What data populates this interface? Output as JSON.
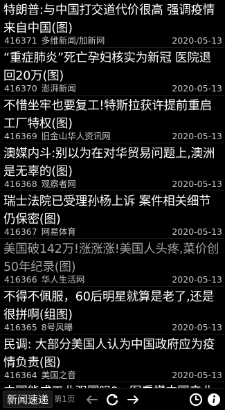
{
  "toolbar": {
    "brand_label": "新闻速递",
    "page_label": "第1页"
  },
  "icons": {
    "prev": "arrow-left-icon",
    "refresh": "refresh-icon",
    "next": "arrow-right-icon",
    "history": "clock-icon",
    "info": "info-icon"
  },
  "colors": {
    "background": "#000000",
    "title_unread": "#ffffff",
    "title_read": "#a3a3a3",
    "meta": "#c8c8c8",
    "brand_button_bg": "#1a1a1a"
  },
  "news": [
    {
      "title": "特朗普:与中国打交道代价很高 强调疫情来自中国(图)",
      "id": "416371",
      "source": "多维新闻/加新网",
      "date": "2020-05-13",
      "read": false
    },
    {
      "title": "“重症肺炎”死亡孕妇核实为新冠 医院退回20万(图)",
      "id": "416370",
      "source": "澎湃新闻",
      "date": "2020-05-13",
      "read": false
    },
    {
      "title": "不惜坐牢也要复工!特斯拉获许提前重启工厂特权(图)",
      "id": "416369",
      "source": "旧金山华人资讯网",
      "date": "2020-05-13",
      "read": false
    },
    {
      "title": "澳媒内斗:别以为在对华贸易问题上,澳洲是无辜的(图)",
      "id": "416368",
      "source": "观察者网",
      "date": "2020-05-13",
      "read": false
    },
    {
      "title": "瑞士法院已受理孙杨上诉 案件相关细节仍保密(图)",
      "id": "416367",
      "source": "网易体育",
      "date": "2020-05-13",
      "read": false
    },
    {
      "title": "美国破142万!涨涨涨!美国人头疼,菜价创50年纪录(图)",
      "id": "416366",
      "source": "华人生活网",
      "date": "2020-05-13",
      "read": true
    },
    {
      "title": "不得不佩服，60后明星就算是老了,还是很拼啊(组图)",
      "id": "416365",
      "source": "8号风曝",
      "date": "2020-05-13",
      "read": false
    },
    {
      "title": "民调: 大部分美国人认为中国政府应为疫情负责(图)",
      "id": "416364",
      "source": "美国之音",
      "date": "2020-05-13",
      "read": false
    },
    {
      "title": "中国能成工业强国吗?一图看懂中国产业",
      "id": "",
      "source": "",
      "date": "",
      "read": false
    }
  ]
}
